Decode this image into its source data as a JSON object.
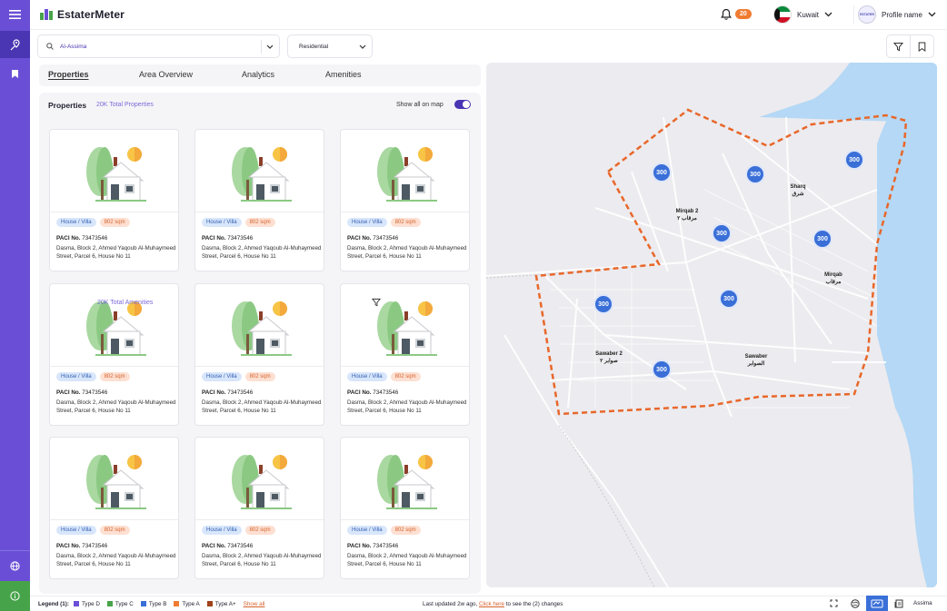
{
  "app": {
    "name": "EstaterMeter"
  },
  "header": {
    "notifications": "20",
    "country": "Kuwait",
    "profile_name": "Profile name",
    "avatar_text": "ESTATER"
  },
  "filters": {
    "area": "Al-Assima",
    "type": "Residential"
  },
  "tabs": [
    {
      "label": "Properties",
      "active": true
    },
    {
      "label": "Area Overview",
      "active": false
    },
    {
      "label": "Analytics",
      "active": false
    },
    {
      "label": "Amenities",
      "active": false
    }
  ],
  "panel": {
    "title": "Properties",
    "count": "20K Total Properties",
    "show_all_label": "Show all on map",
    "show_all_on": true,
    "ghost_label": "20K Total Amenities"
  },
  "cards": [
    {
      "type": "House / Villa",
      "size": "802 sqm",
      "paci_label": "PACI No.",
      "paci": "73473546",
      "address": "Dasma, Block 2, Ahmed Yaqoub Al-Muhaymeed Street, Parcel 6, House No 11"
    },
    {
      "type": "House / Villa",
      "size": "802 sqm",
      "paci_label": "PACI No.",
      "paci": "73473546",
      "address": "Dasma, Block 2, Ahmed Yaqoub Al-Muhaymeed Street, Parcel 6, House No 11"
    },
    {
      "type": "House / Villa",
      "size": "802 sqm",
      "paci_label": "PACI No.",
      "paci": "73473546",
      "address": "Dasma, Block 2, Ahmed Yaqoub Al-Muhaymeed Street, Parcel 6, House No 11"
    },
    {
      "type": "House / Villa",
      "size": "802 sqm",
      "paci_label": "PACI No.",
      "paci": "73473546",
      "address": "Dasma, Block 2, Ahmed Yaqoub Al-Muhaymeed Street, Parcel 6, House No 11"
    },
    {
      "type": "House / Villa",
      "size": "802 sqm",
      "paci_label": "PACI No.",
      "paci": "73473546",
      "address": "Dasma, Block 2, Ahmed Yaqoub Al-Muhaymeed Street, Parcel 6, House No 11"
    },
    {
      "type": "House / Villa",
      "size": "802 sqm",
      "paci_label": "PACI No.",
      "paci": "73473546",
      "address": "Dasma, Block 2, Ahmed Yaqoub Al-Muhaymeed Street, Parcel 6, House No 11"
    },
    {
      "type": "House / Villa",
      "size": "802 sqm",
      "paci_label": "PACI No.",
      "paci": "73473546",
      "address": "Dasma, Block 2, Ahmed Yaqoub Al-Muhaymeed Street, Parcel 6, House No 11"
    },
    {
      "type": "House / Villa",
      "size": "802 sqm",
      "paci_label": "PACI No.",
      "paci": "73473546",
      "address": "Dasma, Block 2, Ahmed Yaqoub Al-Muhaymeed Street, Parcel 6, House No 11"
    },
    {
      "type": "House / Villa",
      "size": "802 sqm",
      "paci_label": "PACI No.",
      "paci": "73473546",
      "address": "Dasma, Block 2, Ahmed Yaqoub Al-Muhaymeed Street, Parcel 6, House No 11"
    }
  ],
  "map": {
    "clusters": [
      "300",
      "300",
      "300",
      "300",
      "300",
      "300",
      "300",
      "300"
    ],
    "labels": [
      {
        "en": "Sharq",
        "ar": "شرق"
      },
      {
        "en": "Mirqab 2",
        "ar": "مرقاب ٢"
      },
      {
        "en": "Mirqab",
        "ar": "مرقاب"
      },
      {
        "en": "Sawaber 2",
        "ar": "صوابر ٢"
      },
      {
        "en": "Sawaber",
        "ar": "الصوابر"
      }
    ]
  },
  "legend": {
    "title": "Legend (1):",
    "items": [
      {
        "label": "Type D",
        "color": "#6a4fd6"
      },
      {
        "label": "Type C",
        "color": "#47a34a"
      },
      {
        "label": "Type B",
        "color": "#3a6fd8"
      },
      {
        "label": "Type A",
        "color": "#f07c32"
      },
      {
        "label": "Type A+",
        "color": "#a0421c"
      }
    ],
    "show_all": "Show all",
    "updated_prefix": "Last updated 2w ago,",
    "click_here": "Click here",
    "updated_suffix": "to see the (2) changes",
    "location": "Assima"
  },
  "colors": {
    "brand": "#6a4fd6",
    "accent": "#f07c32",
    "cluster": "#3a6fd8",
    "boundary": "#e8672a"
  }
}
